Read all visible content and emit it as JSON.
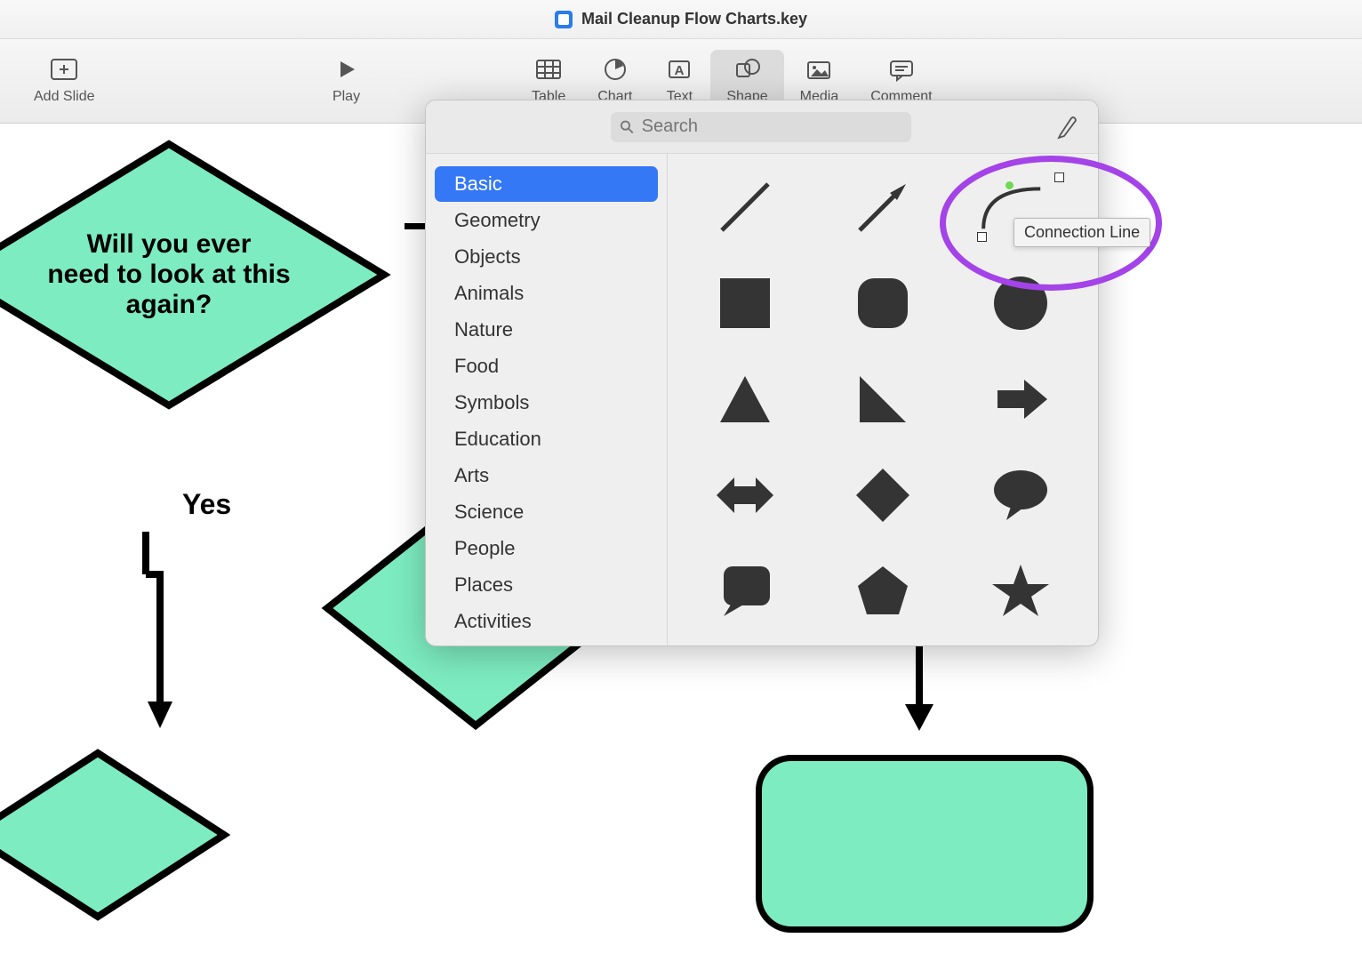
{
  "window": {
    "title": "Mail Cleanup Flow Charts.key"
  },
  "toolbar": {
    "addSlide": "Add Slide",
    "play": "Play",
    "table": "Table",
    "chart": "Chart",
    "text": "Text",
    "shape": "Shape",
    "media": "Media",
    "comment": "Comment"
  },
  "canvas": {
    "diamond1_line1": "Will you ever",
    "diamond1_line2": "need to look at this",
    "diamond1_line3": "again?",
    "yes_label": "Yes"
  },
  "popover": {
    "search_placeholder": "Search",
    "categories": [
      "Basic",
      "Geometry",
      "Objects",
      "Animals",
      "Nature",
      "Food",
      "Symbols",
      "Education",
      "Arts",
      "Science",
      "People",
      "Places",
      "Activities"
    ],
    "selected_category": "Basic",
    "tooltip": "Connection Line"
  }
}
